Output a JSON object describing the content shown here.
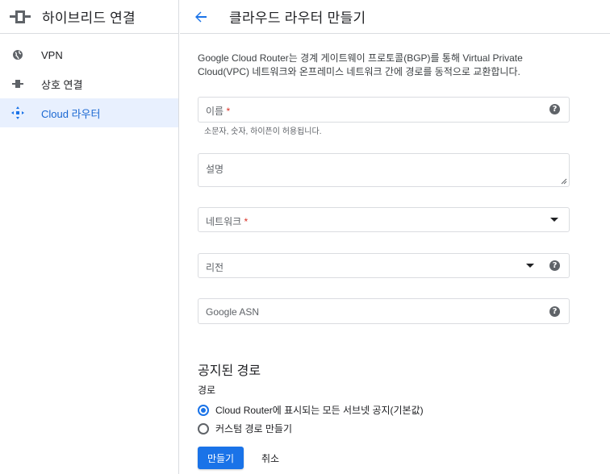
{
  "sidebar": {
    "title": "하이브리드 연결",
    "items": [
      {
        "label": "VPN",
        "icon": "vpn-globe-icon"
      },
      {
        "label": "상호 연결",
        "icon": "interconnect-icon"
      },
      {
        "label": "Cloud 라우터",
        "icon": "cloud-router-icon",
        "active": true
      }
    ]
  },
  "header": {
    "title": "클라우드 라우터 만들기"
  },
  "form": {
    "description": "Google Cloud Router는 경계 게이트웨이 프로토콜(BGP)를 통해 Virtual Private Cloud(VPC) 네트워크와 온프레미스 네트워크 간에 경로를 동적으로 교환합니다.",
    "name_label": "이름",
    "name_required": "*",
    "name_hint": "소문자, 숫자, 하이픈이 허용됩니다.",
    "description_label": "설명",
    "network_label": "네트워크",
    "network_required": "*",
    "region_label": "리전",
    "asn_label": "Google ASN"
  },
  "routes": {
    "section_title": "공지된 경로",
    "sub_label": "경로",
    "options": [
      {
        "label": "Cloud Router에 표시되는 모든 서브넷 공지(기본값)",
        "checked": true
      },
      {
        "label": "커스텀 경로 만들기",
        "checked": false
      }
    ]
  },
  "actions": {
    "create_label": "만들기",
    "cancel_label": "취소"
  },
  "colors": {
    "accent": "#1a73e8",
    "active_bg": "#e8f0fe",
    "required": "#d93025"
  }
}
